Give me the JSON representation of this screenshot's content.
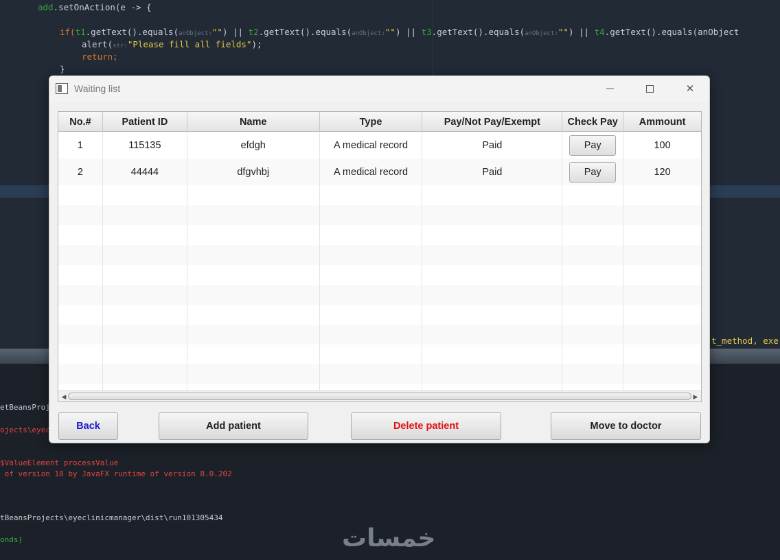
{
  "ide": {
    "code_lines": {
      "l1_obj": "add",
      "l1_rest": ".setOnAction(e -> {",
      "l3_if": "if(",
      "l3_t1": "t1",
      "l3_call1": ".getText().equals(",
      "l3_hint": "anObject:",
      "l3_str": "\"\"",
      "l3_or1": ") || ",
      "l3_t2": "t2",
      "l3_or2": ") || ",
      "l3_t3": "t3",
      "l3_or3": ") || ",
      "l3_t4": "t4",
      "l3_tail": ".getText().equals(anObject",
      "l4_alert": "alert(",
      "l4_hint": "str:",
      "l4_str": "\"Please fill all fields\"",
      "l4_end": ");",
      "l5": "return;",
      "l6": "}",
      "side_snippet": "t_method, exe"
    },
    "output_lines": [
      {
        "text": "etBeansProj",
        "color": "white"
      },
      {
        "text": "ojects\\eyec",
        "color": "red"
      },
      {
        "text": "$ValueElement processValue",
        "color": "red"
      },
      {
        "text": " of version 18 by JavaFX runtime of version 8.0.202",
        "color": "red"
      },
      {
        "text": "tBeansProjects\\eyeclinicmanager\\dist\\run101305434",
        "color": "white"
      },
      {
        "text": "onds)",
        "color": "green"
      }
    ],
    "watermark": "خمسات"
  },
  "window": {
    "title": "Waiting list",
    "controls": {
      "minimize": "minimize",
      "maximize": "maximize",
      "close": "✕"
    }
  },
  "table": {
    "columns": [
      "No.#",
      "Patient ID",
      "Name",
      "Type",
      "Pay/Not Pay/Exempt",
      "Check Pay",
      "Ammount"
    ],
    "rows": [
      {
        "no": "1",
        "patient_id": "115135",
        "name": "efdgh",
        "type": "A medical record",
        "status": "Paid",
        "check_label": "Pay",
        "amount": "100"
      },
      {
        "no": "2",
        "patient_id": "44444",
        "name": "dfgvhbj",
        "type": "A medical record",
        "status": "Paid",
        "check_label": "Pay",
        "amount": "120"
      }
    ],
    "scroll": {
      "left_arrow": "◀",
      "right_arrow": "▶"
    }
  },
  "actions": {
    "back": "Back",
    "add": "Add patient",
    "delete": "Delete patient",
    "move": "Move to doctor"
  },
  "colors": {
    "back_text": "#1a1acc",
    "delete_text": "#e01010",
    "ide_background": "#212a35"
  }
}
